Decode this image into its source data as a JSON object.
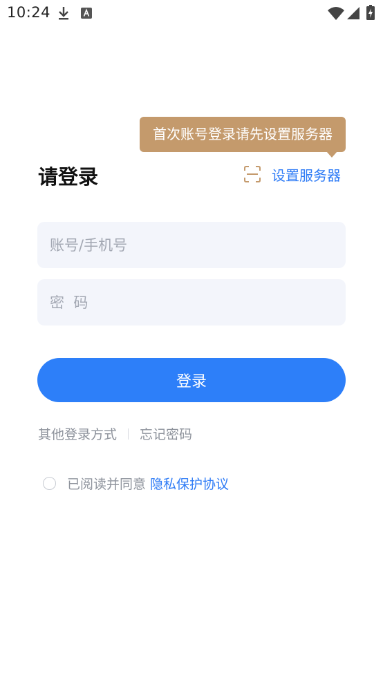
{
  "status_bar": {
    "time": "10:24"
  },
  "tooltip": {
    "text": "首次账号登录请先设置服务器"
  },
  "page": {
    "title": "请登录"
  },
  "server": {
    "label": "设置服务器"
  },
  "form": {
    "account_placeholder": "账号/手机号",
    "password_placeholder": "密  码"
  },
  "login_button": {
    "label": "登录"
  },
  "links": {
    "other_login": "其他登录方式",
    "forgot_password": "忘记密码"
  },
  "agreement": {
    "prefix": "已阅读并同意",
    "link": "隐私保护协议",
    "checked": false
  },
  "colors": {
    "accent": "#2d7ff9",
    "tooltip": "#c49a6c",
    "field_bg": "#f3f5fb",
    "muted_text": "#8e939c"
  }
}
